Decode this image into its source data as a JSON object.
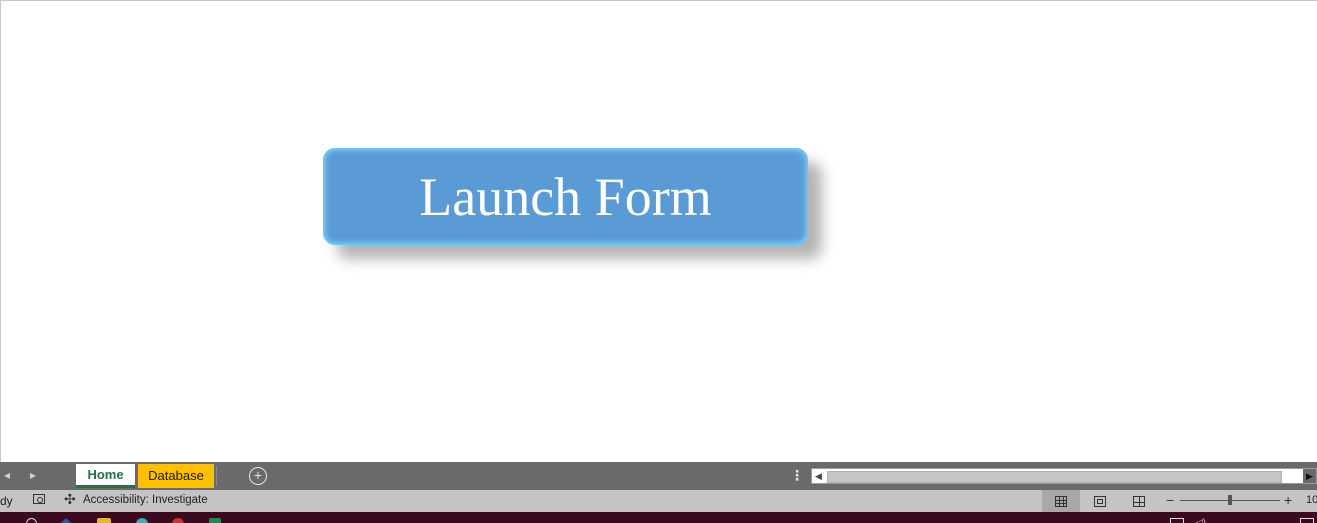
{
  "canvas": {
    "button_label": "Launch Form"
  },
  "sheet_tabs": {
    "tabs": [
      {
        "label": "Home",
        "active": true
      },
      {
        "label": "Database",
        "active": false,
        "color": "#ffc000"
      }
    ],
    "add_sheet_symbol": "+",
    "nav_prev_symbol": "◂",
    "nav_next_symbol": "▸",
    "split_symbol": "⋮"
  },
  "status_bar": {
    "ready_text": "dy",
    "accessibility_text": "Accessibility: Investigate",
    "zoom_minus": "−",
    "zoom_plus": "+",
    "zoom_level": "10",
    "zoom_fraction": 0.5
  },
  "icons": {
    "macro": "macro-record-icon",
    "accessibility": "accessibility-icon",
    "views": [
      "normal-view-icon",
      "page-layout-view-icon",
      "page-break-view-icon"
    ]
  },
  "colors": {
    "button_fill": "#5b9bd5",
    "button_glow": "#7fd4ff",
    "active_tab_text": "#217346",
    "database_tab": "#ffc000",
    "tabbar_bg": "#6a6a6a",
    "statusbar_bg": "#c4c4c4",
    "taskbar_bg": "#3b0a1e"
  }
}
